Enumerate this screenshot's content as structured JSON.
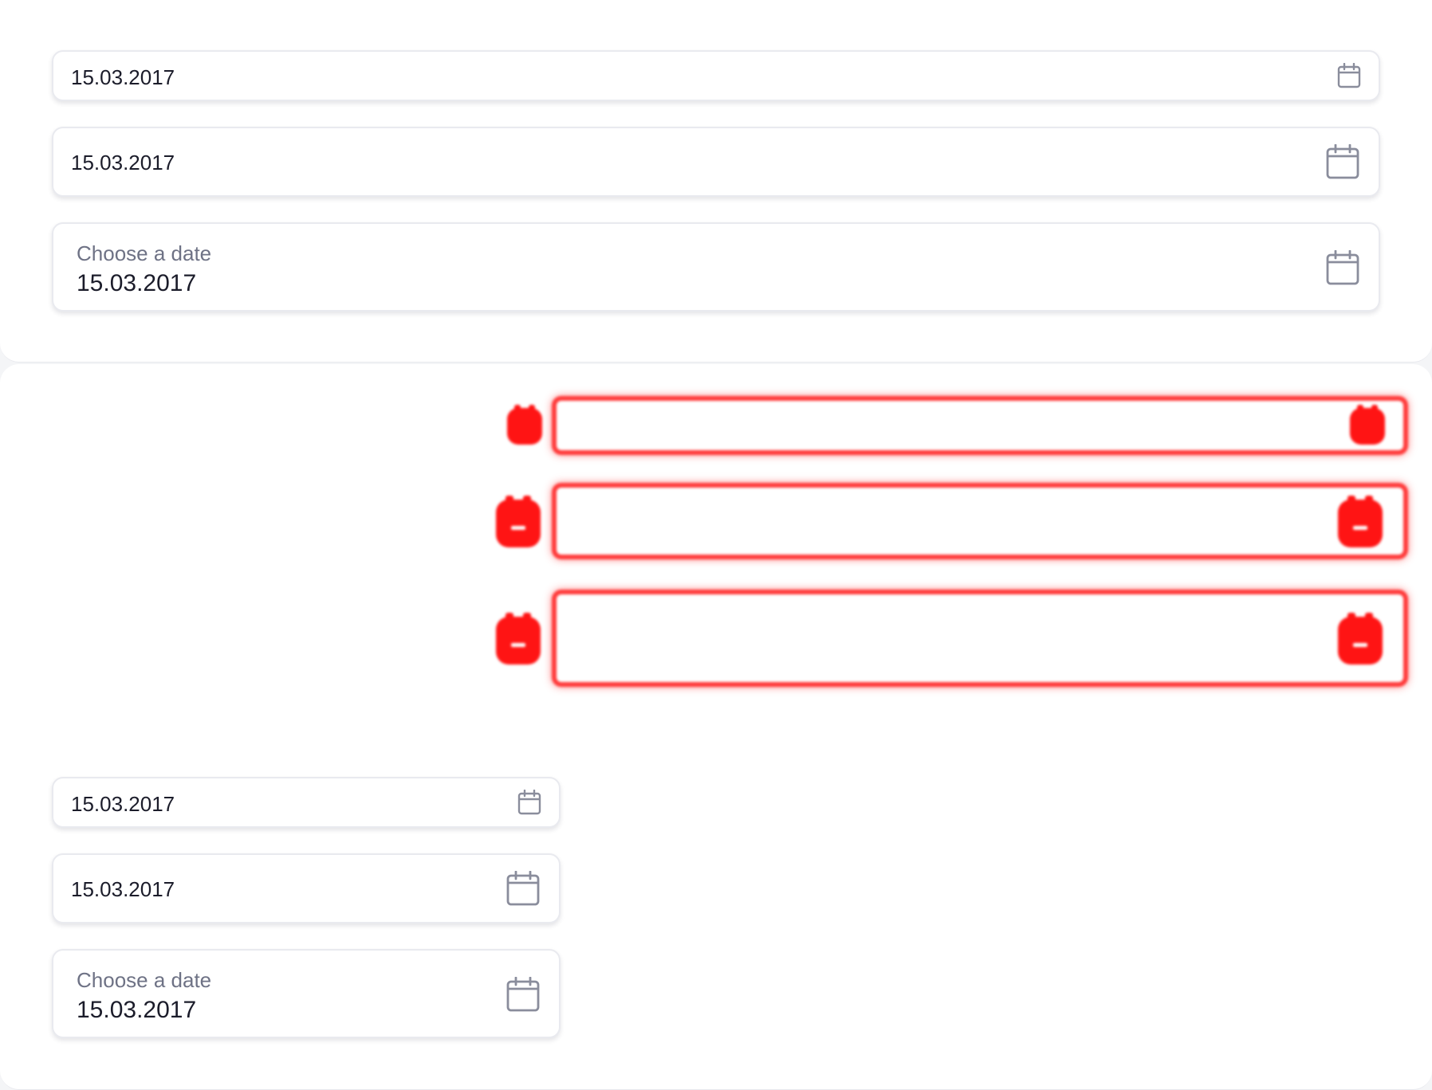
{
  "colors": {
    "text": "#1b1c2a",
    "label": "#6e7285",
    "border": "#e9eaef",
    "icon": "#8a8d9c",
    "overlay_red": "#ff1a1a"
  },
  "top_panel": {
    "field_small": {
      "value": "15.03.2017",
      "icon": "calendar-icon"
    },
    "field_medium": {
      "value": "15.03.2017",
      "icon": "calendar-icon"
    },
    "field_labeled": {
      "label": "Choose a date",
      "value": "15.03.2017",
      "icon": "calendar-icon"
    }
  },
  "bottom_panel": {
    "field_small": {
      "value": "15.03.2017",
      "icon": "calendar-icon"
    },
    "field_medium": {
      "value": "15.03.2017",
      "icon": "calendar-icon"
    },
    "field_labeled": {
      "label": "Choose a date",
      "value": "15.03.2017",
      "icon": "calendar-icon"
    }
  },
  "overlay_rows": [
    {
      "left_icon": "calendar-icon",
      "right_icon": "calendar-icon"
    },
    {
      "left_icon": "calendar-icon",
      "right_icon": "calendar-icon"
    },
    {
      "left_icon": "calendar-icon",
      "right_icon": "calendar-icon"
    }
  ]
}
